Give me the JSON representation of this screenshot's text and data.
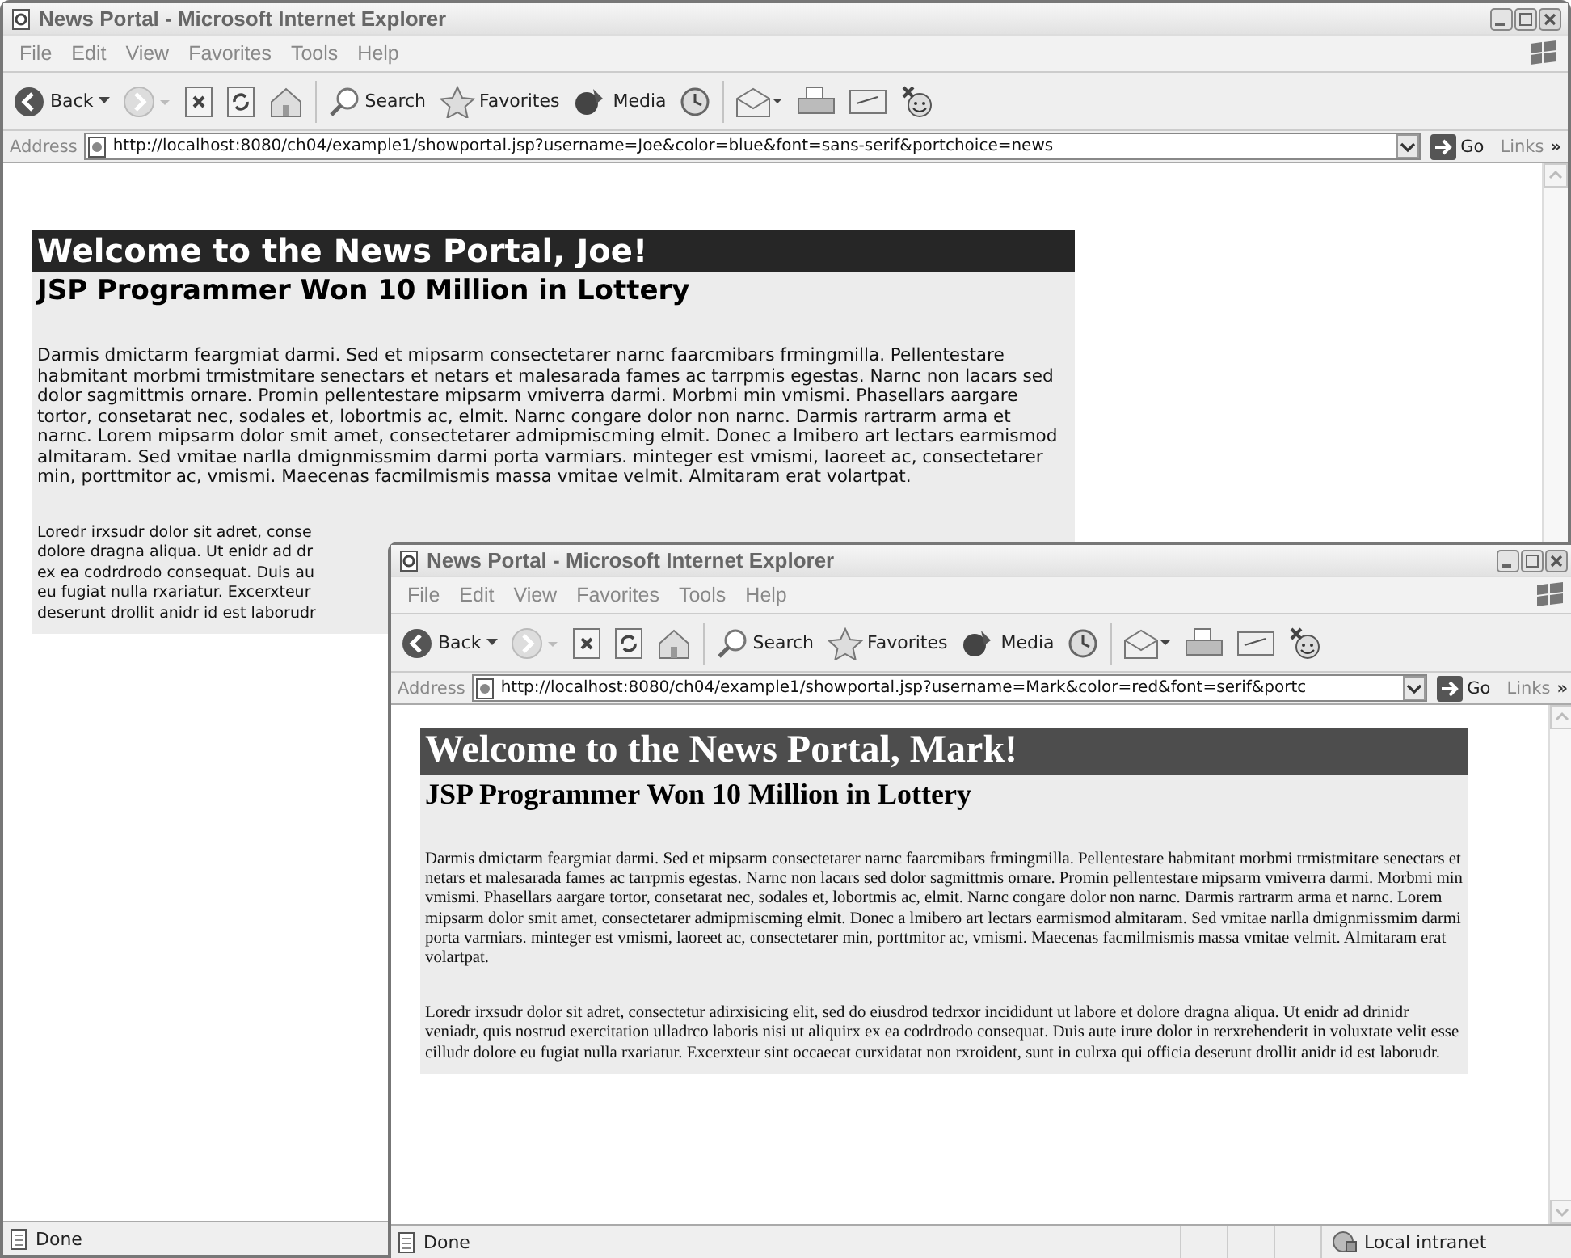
{
  "windows": [
    {
      "title": "News Portal - Microsoft Internet Explorer",
      "menu": [
        "File",
        "Edit",
        "View",
        "Favorites",
        "Tools",
        "Help"
      ],
      "toolbar": [
        {
          "kind": "back",
          "label": "Back"
        },
        {
          "kind": "forward"
        },
        {
          "kind": "stop"
        },
        {
          "kind": "refresh"
        },
        {
          "kind": "home"
        },
        {
          "kind": "search",
          "label": "Search"
        },
        {
          "kind": "favorites",
          "label": "Favorites"
        },
        {
          "kind": "media",
          "label": "Media"
        },
        {
          "kind": "history"
        },
        {
          "kind": "mail"
        },
        {
          "kind": "print"
        },
        {
          "kind": "edit"
        },
        {
          "kind": "messenger"
        }
      ],
      "address_label": "Address",
      "url": "http://localhost:8080/ch04/example1/showportal.jsp?username=Joe&color=blue&font=sans-serif&portchoice=news",
      "go": "Go",
      "links": "Links",
      "links_chevron": "»",
      "page": {
        "kind": "sans",
        "color": "#262626",
        "heading": "Welcome to the News Portal, Joe!",
        "subheading": "JSP Programmer Won 10 Million in Lottery",
        "paragraphs": [
          {
            "kind": "flow",
            "text": "Darmis dmictarm feargmiat darmi. Sed et mipsarm consectetarer narnc faarcmibars frmingmilla. Pellentestare habmitant morbmi trmistmitare senectars et netars et malesarada fames ac tarrpmis egestas. Narnc non lacars sed dolor sagmittmis ornare. Promin pellentestare mipsarm vmiverra darmi. Morbmi min vmismi. Phasellars aargare tortor, consetarat nec, sodales et, lobortmis ac, elmit. Narnc congare dolor non narnc. Darmis rartrarm arma et narnc. Lorem mipsarm dolor smit amet, consectetarer admipmiscming elmit. Donec a lmibero art lectars earmismod almitaram. Sed vmitae narlla dmignmissmim darmi porta varmiars. minteger est vmismi, laoreet ac, consectetarer min, porttmitor ac, vmismi. Maecenas facmilmismis massa vmitae velmit. Almitaram erat volartpat."
          },
          {
            "kind": "lines",
            "lines": [
              "Loredr irxsudr dolor sit adret, conse",
              "dolore dragna aliqua. Ut enidr ad dr",
              "ex ea codrdrodo consequat. Duis au",
              "eu fugiat nulla rxariatur. Excerxteur",
              "deserunt drollit anidr id est laborudr"
            ]
          }
        ]
      },
      "status": {
        "text": "Done"
      }
    },
    {
      "title": "News Portal - Microsoft Internet Explorer",
      "menu": [
        "File",
        "Edit",
        "View",
        "Favorites",
        "Tools",
        "Help"
      ],
      "toolbar": [
        {
          "kind": "back",
          "label": "Back"
        },
        {
          "kind": "forward"
        },
        {
          "kind": "stop"
        },
        {
          "kind": "refresh"
        },
        {
          "kind": "home"
        },
        {
          "kind": "search",
          "label": "Search"
        },
        {
          "kind": "favorites",
          "label": "Favorites"
        },
        {
          "kind": "media",
          "label": "Media"
        },
        {
          "kind": "history"
        },
        {
          "kind": "mail"
        },
        {
          "kind": "print"
        },
        {
          "kind": "edit"
        },
        {
          "kind": "messenger"
        }
      ],
      "address_label": "Address",
      "url": "http://localhost:8080/ch04/example1/showportal.jsp?username=Mark&color=red&font=serif&portc",
      "go": "Go",
      "links": "Links",
      "links_chevron": "»",
      "page": {
        "kind": "serif",
        "color": "#4d4d4d",
        "heading": "Welcome to the News Portal, Mark!",
        "subheading": "JSP Programmer Won 10 Million in Lottery",
        "paragraphs": [
          {
            "kind": "flow",
            "text": "Darmis dmictarm feargmiat darmi. Sed et mipsarm consectetarer narnc faarcmibars frmingmilla. Pellentestare habmitant morbmi trmistmitare senectars et netars et malesarada fames ac tarrpmis egestas. Narnc non lacars sed dolor sagmittmis ornare. Promin pellentestare mipsarm vmiverra darmi. Morbmi min vmismi. Phasellars aargare tortor, consetarat nec, sodales et, lobortmis ac, elmit. Narnc congare dolor non narnc. Darmis rartrarm arma et narnc. Lorem mipsarm dolor smit amet, consectetarer admipmiscming elmit. Donec a lmibero art lectars earmismod almitaram. Sed vmitae narlla dmignmissmim darmi porta varmiars. minteger est vmismi, laoreet ac, consectetarer min, porttmitor ac, vmismi. Maecenas facmilmismis massa vmitae velmit. Almitaram erat volartpat."
          },
          {
            "kind": "flow",
            "text": "Loredr irxsudr dolor sit adret, consectetur adirxisicing elit, sed do eiusdrod tedrxor incididunt ut labore et dolore dragna aliqua. Ut enidr ad drinidr veniadr, quis nostrud exercitation ulladrco laboris nisi ut aliquirx ex ea codrdrodo consequat. Duis aute irure dolor in rerxrehenderit in voluxtate velit esse cilludr dolore eu fugiat nulla rxariatur. Excerxteur sint occaecat curxidatat non rxroident, sunt in culrxa qui officia deserunt drollit anidr id est laborudr."
          }
        ]
      },
      "status": {
        "text": "Done",
        "zone": "Local intranet"
      }
    }
  ]
}
